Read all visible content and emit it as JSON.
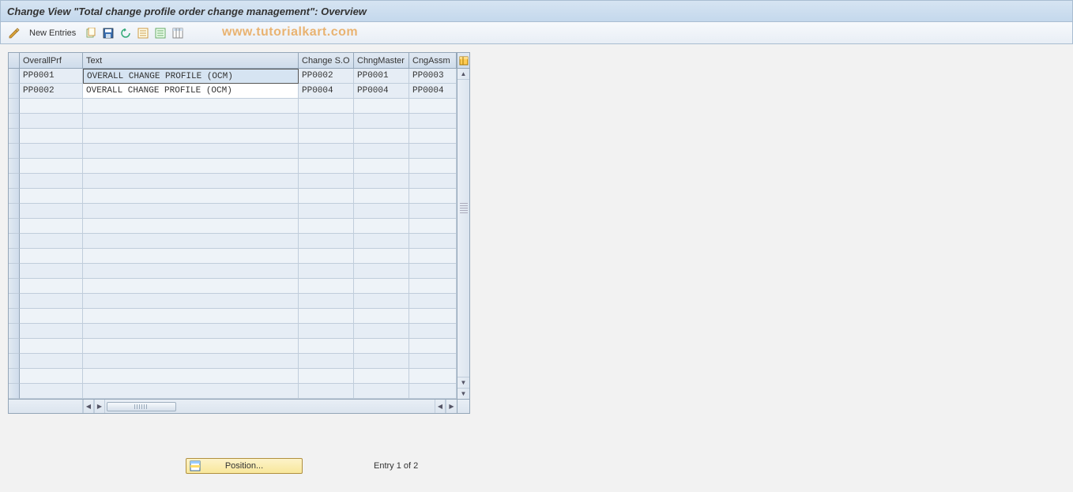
{
  "title": "Change View \"Total change profile order change management\": Overview",
  "toolbar": {
    "new_entries": "New Entries"
  },
  "watermark": "www.tutorialkart.com",
  "table": {
    "headers": {
      "overall": "OverallPrf",
      "text": "Text",
      "changeso": "Change S.O",
      "chngmaster": "ChngMaster",
      "cngassm": "CngAssm"
    },
    "rows": [
      {
        "overall": "PP0001",
        "text": "OVERALL CHANGE PROFILE (OCM)",
        "changeso": "PP0002",
        "chngmaster": "PP0001",
        "cngassm": "PP0003",
        "selected": true
      },
      {
        "overall": "PP0002",
        "text": "OVERALL CHANGE PROFILE (OCM)",
        "changeso": "PP0004",
        "chngmaster": "PP0004",
        "cngassm": "PP0004",
        "selected": false
      }
    ],
    "blank_rows": 20
  },
  "footer": {
    "position_btn": "Position...",
    "entry_text": "Entry 1 of 2"
  }
}
